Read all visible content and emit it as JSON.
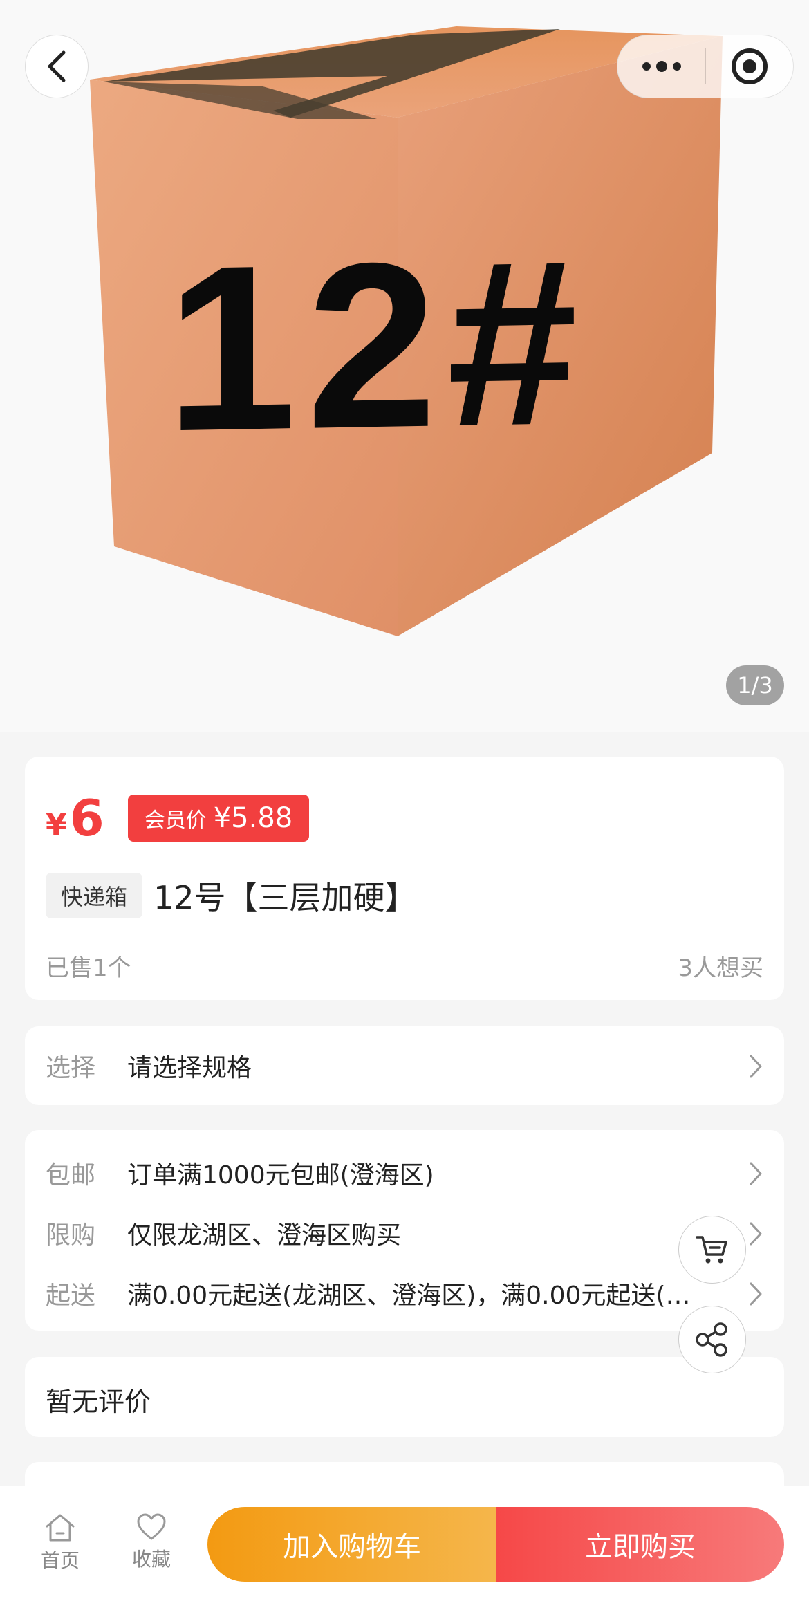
{
  "hero": {
    "box_label": "12#",
    "counter": "1/3",
    "icons": {
      "back": "back-chevron-icon",
      "more": "more-dots-icon",
      "close": "target-icon"
    }
  },
  "price": {
    "currency": "¥",
    "value": "6",
    "member_label": "会员价",
    "member_value": "¥5.88"
  },
  "product": {
    "tag": "快递箱",
    "title": "12号【三层加硬】",
    "sold": "已售1个",
    "want": "3人想买"
  },
  "spec": {
    "key": "选择",
    "value": "请选择规格"
  },
  "policies": [
    {
      "key": "包邮",
      "value": "订单满1000元包邮(澄海区)"
    },
    {
      "key": "限购",
      "value": "仅限龙湖区、澄海区购买"
    },
    {
      "key": "起送",
      "value": "满0.00元起送(龙湖区、澄海区)，满0.00元起送(…"
    }
  ],
  "review": {
    "text": "暂无评价"
  },
  "float_buttons": {
    "cart": "cart-icon",
    "share": "share-icon"
  },
  "bottom": {
    "home_label": "首页",
    "fav_label": "收藏",
    "add_cart": "加入购物车",
    "buy_now": "立即购买"
  },
  "colors": {
    "accent_red": "#f23f3f",
    "cart_orange": "#f39a12",
    "box_brown": "#e39a6e"
  }
}
